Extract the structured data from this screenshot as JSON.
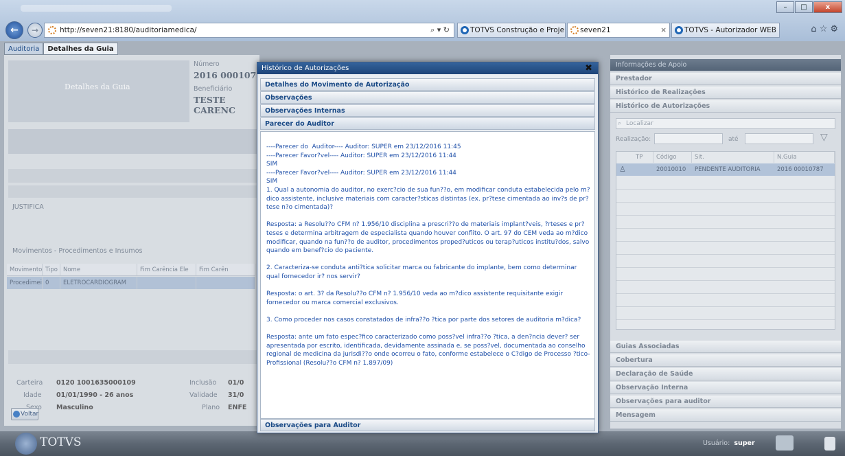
{
  "browser": {
    "url": "http://seven21:8180/auditoriamedica/",
    "url_host": "seven21",
    "tabs": [
      {
        "label": "TOTVS Construção e Proje..."
      },
      {
        "label": "seven21"
      },
      {
        "label": "TOTVS - Autorizador WEB"
      }
    ],
    "search_refresh": "⌕ ▾ ↻",
    "tab_close": "×",
    "window_controls": {
      "minimize": "–",
      "maximize": "□",
      "close": "x"
    }
  },
  "app_tabs": [
    "Auditoria",
    "Detalhes da Guia"
  ],
  "guia": {
    "section_title": "Detalhes da Guia",
    "numero_label": "Número",
    "numero_value": "2016 000107",
    "beneficiario_label": "Beneficiário",
    "beneficiario_value": "TESTE CARENC",
    "justifica_label": "JUSTIFICA",
    "movimentos_title": "Movimentos - Procedimentos e Insumos",
    "grid_columns": [
      "Movimento",
      "Tipo",
      "Nome",
      "Fim Carência Ele",
      "Fim Carên"
    ],
    "grid_rows": [
      [
        "Procedimei",
        "0",
        "ELETROCARDIOGRAM",
        "",
        ""
      ]
    ],
    "carteira_label": "Carteira",
    "carteira_value": "0120 1001635000109",
    "idade_label": "Idade",
    "idade_value": "01/01/1990 - 26 anos",
    "sexo_label": "Sexo",
    "sexo_value": "Masculino",
    "inclusao_label": "Inclusão",
    "inclusao_value": "01/0",
    "validade_label": "Validade",
    "validade_value": "31/0",
    "plano_label": "Plano",
    "plano_value": "ENFE",
    "voltar_label": "Voltar"
  },
  "modal": {
    "title": "Histórico de Autorizações",
    "close_glyph": "✖",
    "sections": [
      "Detalhes do Movimento de Autorização",
      "Observações",
      "Observações Internas",
      "Parecer do Auditor"
    ],
    "parecer_text": "----Parecer do  Auditor---- Auditor: SUPER em 23/12/2016 11:45\n----Parecer Favor?vel---- Auditor: SUPER em 23/12/2016 11:44\nSIM\n----Parecer Favor?vel---- Auditor: SUPER em 23/12/2016 11:44\nSIM\n1. Qual a autonomia do auditor, no exerc?cio de sua fun??o, em modificar conduta estabelecida pelo m?dico assistente, inclusive materiais com caracter?sticas distintas (ex. pr?tese cimentada ao inv?s de pr?tese n?o cimentada)?\n\nResposta: a Resolu??o CFM n? 1.956/10 disciplina a prescri??o de materiais implant?veis, ?rteses e pr?teses e determina arbitragem de especialista quando houver conflito. O art. 97 do CEM veda ao m?dico modificar, quando na fun??o de auditor, procedimentos proped?uticos ou terap?uticos institu?dos, salvo quando em benef?cio do paciente.\n\n2. Caracteriza-se conduta anti?tica solicitar marca ou fabricante do implante, bem como determinar qual fornecedor ir? nos servir?\n\nResposta: o art. 3? da Resolu??o CFM n? 1.956/10 veda ao m?dico assistente requisitante exigir fornecedor ou marca comercial exclusivos.\n\n3. Como proceder nos casos constatados de infra??o ?tica por parte dos setores de auditoria m?dica?\n\nResposta: ante um fato espec?fico caracterizado como poss?vel infra??o ?tica, a den?ncia dever? ser apresentada por escrito, identificada, devidamente assinada e, se poss?vel, documentada ao conselho regional de medicina da jurisdi??o onde ocorreu o fato, conforme estabelece o C?digo de Processo ?tico-Profissional (Resolu??o CFM n? 1.897/09)",
    "footer_section": "Observações para Auditor"
  },
  "apoio": {
    "title": "Informações de Apoio",
    "top_sections": [
      "Prestador",
      "Histórico de Realizações",
      "Histórico de Autorizações"
    ],
    "search_placeholder": "Localizar",
    "realizacao_label": "Realização:",
    "ate_label": "até",
    "table_columns": [
      "TP",
      "Código",
      "Sit.",
      "N.Guia"
    ],
    "table_rows": [
      {
        "codigo": "20010010",
        "situacao": "PENDENTE AUDITORIA",
        "guia": "2016 00010787"
      }
    ],
    "bottom_sections": [
      "Guias Associadas",
      "Cobertura",
      "Declaração de Saúde",
      "Observação Interna",
      "Observações para auditor",
      "Mensagem"
    ]
  },
  "footer": {
    "brand": "TOTVS",
    "usuario_label": "Usuário:",
    "usuario_value": "super"
  }
}
